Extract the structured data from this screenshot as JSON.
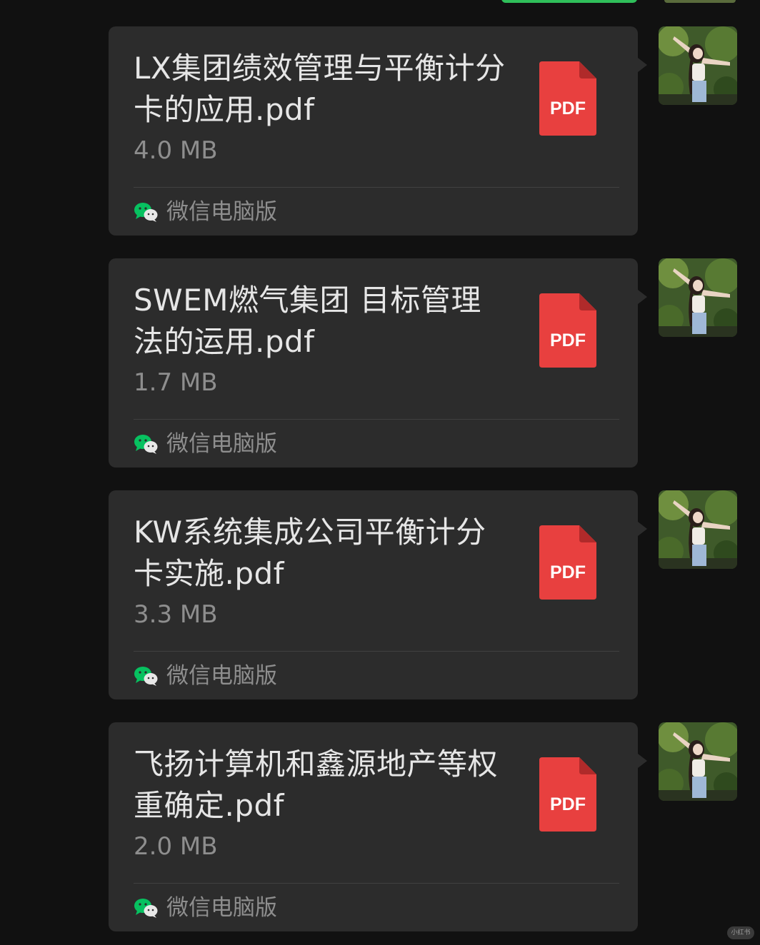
{
  "messages": [
    {
      "file_name": "LX集团绩效管理与平衡计分卡的应用.pdf",
      "file_size": "4.0 MB",
      "file_type": "PDF",
      "source": "微信电脑版"
    },
    {
      "file_name": "SWEM燃气集团 目标管理法的运用.pdf",
      "file_size": "1.7 MB",
      "file_type": "PDF",
      "source": "微信电脑版"
    },
    {
      "file_name": "KW系统集成公司平衡计分卡实施.pdf",
      "file_size": "3.3 MB",
      "file_type": "PDF",
      "source": "微信电脑版"
    },
    {
      "file_name": "飞扬计算机和鑫源地产等权重确定.pdf",
      "file_size": "2.0 MB",
      "file_type": "PDF",
      "source": "微信电脑版"
    }
  ],
  "watermark": "小红书",
  "colors": {
    "background": "#111111",
    "bubble": "#2c2c2c",
    "pdf_red": "#e8403f",
    "wechat_green": "#07c160"
  },
  "icons": {
    "file": "pdf-file-icon",
    "source": "wechat-logo-icon",
    "sender": "avatar"
  }
}
